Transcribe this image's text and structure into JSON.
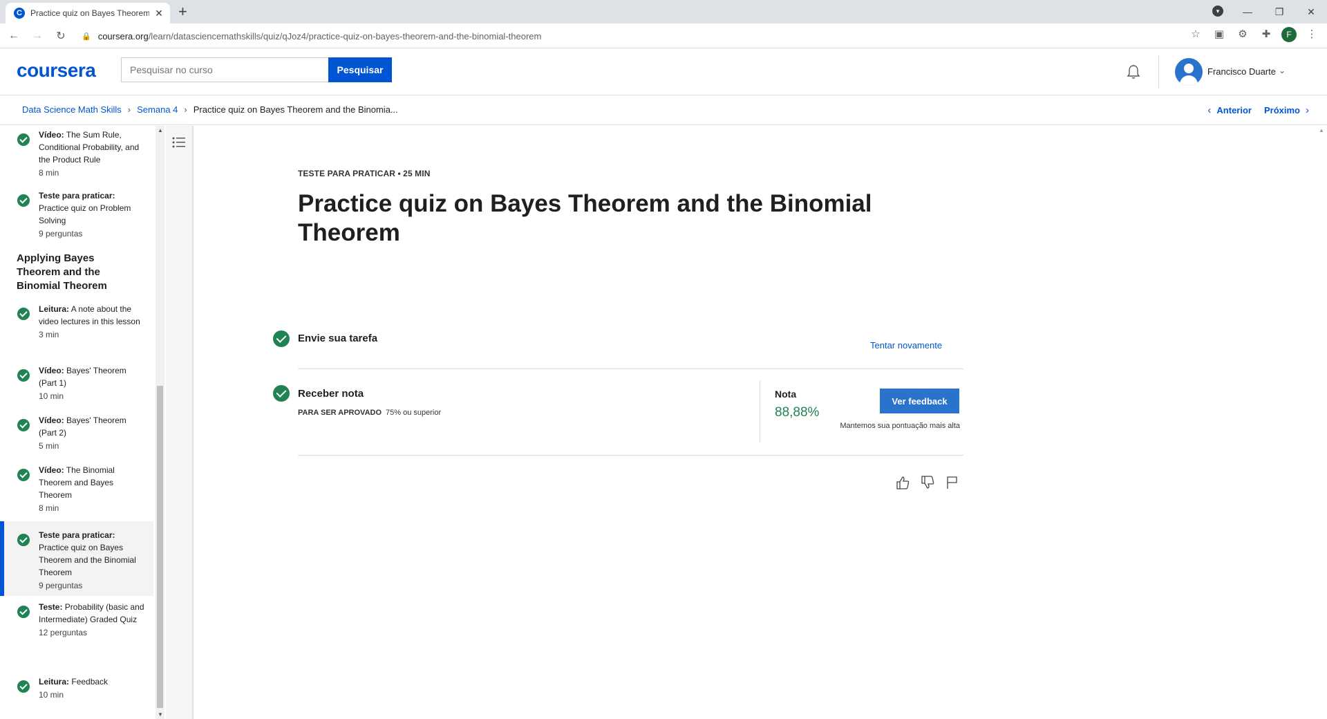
{
  "browser": {
    "tab_title": "Practice quiz on Bayes Theorem a",
    "url_host": "coursera.org",
    "url_path": "/learn/datasciencemathskills/quiz/qJoz4/practice-quiz-on-bayes-theorem-and-the-binomial-theorem",
    "profile_initial": "F"
  },
  "header": {
    "logo": "coursera",
    "search_placeholder": "Pesquisar no curso",
    "search_button": "Pesquisar",
    "user_name": "Francisco Duarte"
  },
  "breadcrumb": {
    "course": "Data Science Math Skills",
    "week": "Semana 4",
    "current": "Practice quiz on Bayes Theorem and the Binomia..."
  },
  "pager": {
    "previous": "Anterior",
    "next": "Próximo"
  },
  "sidebar": {
    "items_top": [
      {
        "type": "Vídeo:",
        "title": "The Sum Rule, Conditional Probability, and the Product Rule",
        "meta": "8 min"
      },
      {
        "type": "Teste para praticar:",
        "title": "Practice quiz on Problem Solving",
        "meta": "9 perguntas"
      }
    ],
    "section_title": "Applying Bayes Theorem and the Binomial Theorem",
    "items": [
      {
        "type": "Leitura:",
        "title": "A note about the video lectures in this lesson",
        "meta": "3 min"
      },
      {
        "type": "Vídeo:",
        "title": "Bayes' Theorem (Part 1)",
        "meta": "10 min"
      },
      {
        "type": "Vídeo:",
        "title": "Bayes' Theorem (Part 2)",
        "meta": "5 min"
      },
      {
        "type": "Vídeo:",
        "title": "The Binomial Theorem and Bayes Theorem",
        "meta": "8 min"
      },
      {
        "type": "Teste para praticar:",
        "title": "Practice quiz on Bayes Theorem and the Binomial Theorem",
        "meta": "9 perguntas"
      },
      {
        "type": "Teste:",
        "title": "Probability (basic and Intermediate) Graded Quiz",
        "meta": "12 perguntas"
      },
      {
        "type": "Leitura:",
        "title": "Feedback",
        "meta": "10 min"
      }
    ]
  },
  "quiz": {
    "meta": "TESTE PARA PRATICAR • 25 MIN",
    "title": "Practice quiz on Bayes Theorem and the Binomial Theorem",
    "step_submit": "Envie sua tarefa",
    "retry": "Tentar novamente",
    "step_grade": "Receber nota",
    "pass_label": "PARA SER APROVADO",
    "pass_value": "75% ou superior",
    "grade_label": "Nota",
    "grade_value": "88,88%",
    "feedback_button": "Ver feedback",
    "grade_note": "Mantemos sua pontuação mais alta"
  },
  "colors": {
    "brand": "#0056d2",
    "success": "#1f8354",
    "button": "#2a73cc"
  }
}
